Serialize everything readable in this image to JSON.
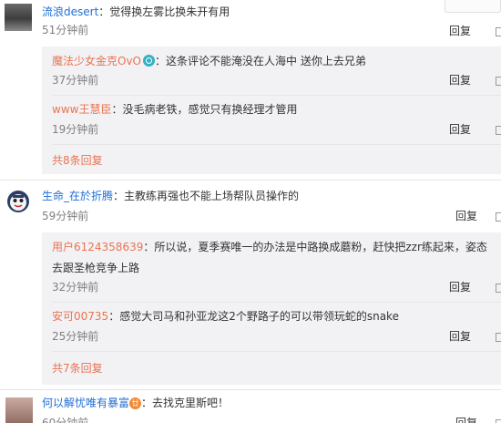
{
  "comments": [
    {
      "user": "流浪desert",
      "text": "觉得换左雾比换朱开有用",
      "time": "51分钟前",
      "reply": "回复",
      "replies": [
        {
          "user": "魔法少女金克OvO",
          "text": "这条评论不能淹没在人海中 送你上去兄弟",
          "time": "37分钟前",
          "reply": "回复",
          "badge": "camera-badge"
        },
        {
          "user": "www王慧臣",
          "text": "没毛病老铁，感觉只有换经理才管用",
          "time": "19分钟前",
          "reply": "回复"
        }
      ],
      "more": "共8条回复"
    },
    {
      "user": "生命_在於折腾",
      "text": "主教练再强也不能上场帮队员操作的",
      "time": "59分钟前",
      "reply": "回复",
      "replies": [
        {
          "user": "用户6124358639",
          "text": "所以说，夏季赛唯一的办法是中路换成蘑粉，赶快把zzr练起来，姿态",
          "text2": "去跟圣枪竞争上路",
          "time": "32分钟前",
          "reply": "回复"
        },
        {
          "user": "安可00735",
          "text": "感觉大司马和孙亚龙这2个野路子的可以带领玩蛇的snake",
          "time": "25分钟前",
          "reply": "回复"
        }
      ],
      "more": "共7条回复"
    },
    {
      "user": "何以解忧唯有暴富",
      "text": "去找克里斯吧！",
      "time": "60分钟前",
      "reply": "回复",
      "badge_text": "廿"
    }
  ],
  "colors": {
    "username": "#eb7350",
    "link_blue": "#1f6ed4",
    "reply_bg": "#f2f2f5",
    "time": "#808080"
  },
  "separator": "："
}
